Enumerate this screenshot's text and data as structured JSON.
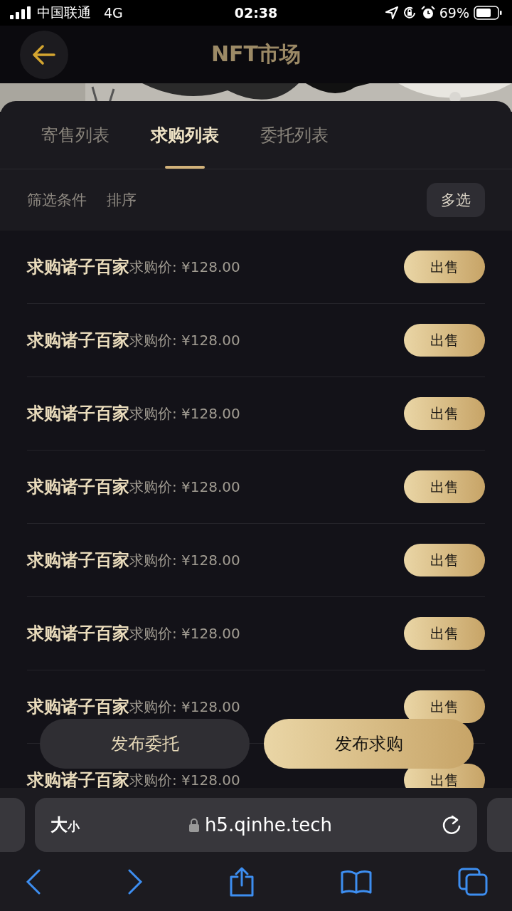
{
  "status_bar": {
    "carrier": "中国联通",
    "network": "4G",
    "time": "02:38",
    "battery": "69%"
  },
  "header": {
    "title": "NFT市场"
  },
  "tabs": [
    {
      "label": "寄售列表",
      "selected": false
    },
    {
      "label": "求购列表",
      "selected": true
    },
    {
      "label": "委托列表",
      "selected": false
    }
  ],
  "filters": {
    "conditions": "筛选条件",
    "sort": "排序",
    "multi_select": "多选"
  },
  "rows": [
    {
      "title": "求购诸子百家",
      "price": "求购价: ¥128.00",
      "action": "出售"
    },
    {
      "title": "求购诸子百家",
      "price": "求购价: ¥128.00",
      "action": "出售"
    },
    {
      "title": "求购诸子百家",
      "price": "求购价: ¥128.00",
      "action": "出售"
    },
    {
      "title": "求购诸子百家",
      "price": "求购价: ¥128.00",
      "action": "出售"
    },
    {
      "title": "求购诸子百家",
      "price": "求购价: ¥128.00",
      "action": "出售"
    },
    {
      "title": "求购诸子百家",
      "price": "求购价: ¥128.00",
      "action": "出售"
    },
    {
      "title": "求购诸子百家",
      "price": "求购价: ¥128.00",
      "action": "出售"
    },
    {
      "title": "求购诸子百家",
      "price": "求购价: ¥128.00",
      "action": "出售"
    }
  ],
  "bottom_actions": [
    {
      "label": "发布委托",
      "kind": "secondary"
    },
    {
      "label": "发布求购",
      "kind": "primary"
    }
  ],
  "browser": {
    "text_size_big": "大",
    "text_size_small": "小",
    "url": "h5.qinhe.tech"
  }
}
